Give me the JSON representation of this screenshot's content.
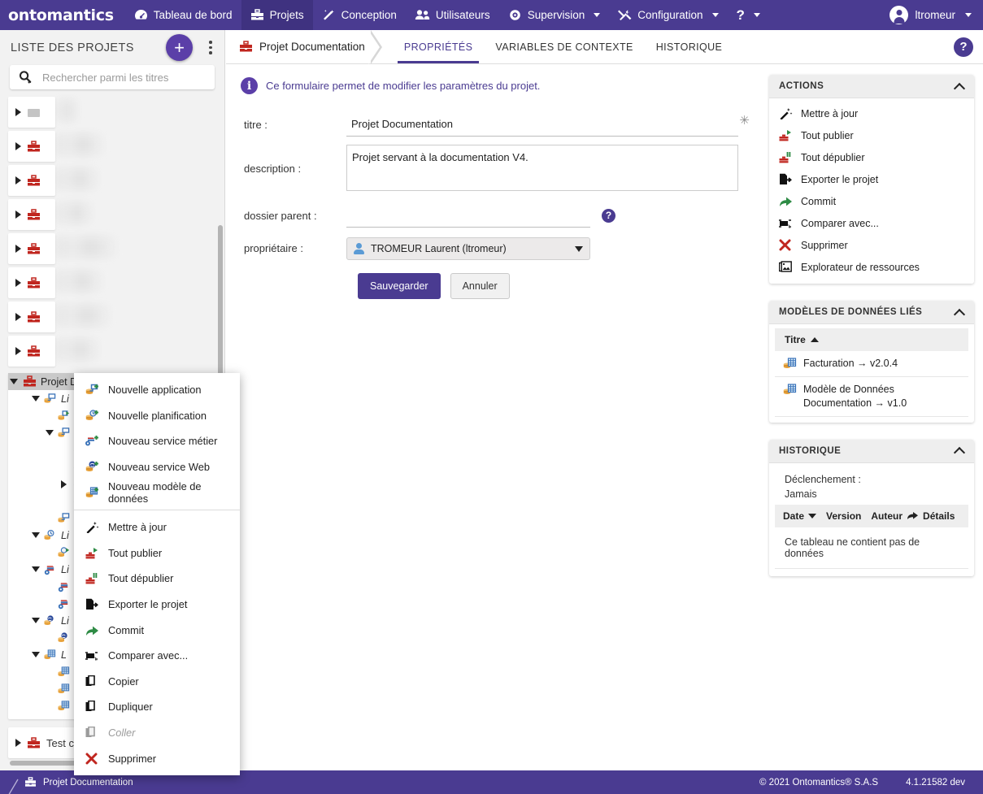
{
  "topnav": {
    "brand": "ontomantics",
    "items": [
      {
        "label": "Tableau de bord",
        "icon": "dashboard-icon",
        "caret": false,
        "active": false
      },
      {
        "label": "Projets",
        "icon": "toolbox-icon",
        "caret": false,
        "active": true
      },
      {
        "label": "Conception",
        "icon": "wand-icon",
        "caret": false,
        "active": false
      },
      {
        "label": "Utilisateurs",
        "icon": "users-icon",
        "caret": false,
        "active": false
      },
      {
        "label": "Supervision",
        "icon": "eye-icon",
        "caret": true,
        "active": false
      },
      {
        "label": "Configuration",
        "icon": "tools-icon",
        "caret": true,
        "active": false
      },
      {
        "label": "?",
        "icon": "help-icon",
        "caret": true,
        "active": false
      }
    ],
    "user": "ltromeur"
  },
  "sidebar": {
    "title": "LISTE DES PROJETS",
    "add_label": "+",
    "search_placeholder": "Rechercher parmi les titres",
    "search_value": "",
    "redacted_rows": 8,
    "selected_project": "Projet Documentation",
    "tree": [
      {
        "indent": 1,
        "twisty": "down",
        "icon": "app-list-icon",
        "label": "Li",
        "italic": true
      },
      {
        "indent": 2,
        "twisty": "none",
        "icon": "app-run-icon",
        "label": "",
        "italic": false
      },
      {
        "indent": 2,
        "twisty": "down",
        "icon": "app-icon",
        "label": "",
        "italic": false
      },
      {
        "indent": 3,
        "twisty": "none",
        "icon": "bolt-icon",
        "label": "",
        "italic": false
      },
      {
        "indent": 3,
        "twisty": "none",
        "icon": "bolt-icon",
        "label": "",
        "italic": false
      },
      {
        "indent": 3,
        "twisty": "right",
        "icon": "bolt-icon",
        "label": "",
        "italic": false
      },
      {
        "indent": 3,
        "twisty": "none",
        "icon": "bolt-icon",
        "label": "",
        "italic": false
      },
      {
        "indent": 2,
        "twisty": "none",
        "icon": "app-icon",
        "label": "",
        "italic": false
      },
      {
        "indent": 1,
        "twisty": "down",
        "icon": "schedule-list-icon",
        "label": "Li",
        "italic": true
      },
      {
        "indent": 2,
        "twisty": "none",
        "icon": "schedule-run-icon",
        "label": "",
        "italic": false
      },
      {
        "indent": 1,
        "twisty": "down",
        "icon": "service-list-icon",
        "label": "Li",
        "italic": true
      },
      {
        "indent": 2,
        "twisty": "none",
        "icon": "service-icon",
        "label": "",
        "italic": false
      },
      {
        "indent": 2,
        "twisty": "none",
        "icon": "service-icon",
        "label": "",
        "italic": false
      },
      {
        "indent": 1,
        "twisty": "down",
        "icon": "webservice-list-icon",
        "label": "Li",
        "italic": true
      },
      {
        "indent": 2,
        "twisty": "none",
        "icon": "webservice-icon",
        "label": "",
        "italic": false
      },
      {
        "indent": 1,
        "twisty": "down",
        "icon": "datamodel-list-icon",
        "label": "L",
        "italic": true
      },
      {
        "indent": 2,
        "twisty": "none",
        "icon": "datamodel-icon",
        "label": "",
        "italic": false
      },
      {
        "indent": 2,
        "twisty": "none",
        "icon": "datamodel-icon",
        "label": "",
        "italic": false
      },
      {
        "indent": 2,
        "twisty": "none",
        "icon": "datamodel-icon",
        "label": "",
        "italic": false
      }
    ],
    "last_item": "Test c"
  },
  "workspace": {
    "breadcrumb": "Projet Documentation",
    "tabs": [
      {
        "label": "PROPRIÉTÉS",
        "active": true
      },
      {
        "label": "VARIABLES DE CONTEXTE",
        "active": false
      },
      {
        "label": "HISTORIQUE",
        "active": false
      }
    ],
    "help_glyph": "?"
  },
  "form": {
    "info_banner": "Ce formulaire permet de modifier les paramètres du projet.",
    "info_glyph": "i",
    "fields": {
      "title_label": "titre :",
      "title_value": "Projet Documentation",
      "title_required_mark": "✳",
      "description_label": "description :",
      "description_value": "Projet servant à la documentation V4.",
      "parent_label": "dossier parent :",
      "parent_value": "",
      "parent_help_glyph": "?",
      "owner_label": "propriétaire :",
      "owner_value": "TROMEUR Laurent (ltromeur)"
    },
    "save_label": "Sauvegarder",
    "cancel_label": "Annuler"
  },
  "actions_panel": {
    "title": "ACTIONS",
    "items": [
      {
        "label": "Mettre à jour",
        "icon": "wand-icon"
      },
      {
        "label": "Tout publier",
        "icon": "publish-icon"
      },
      {
        "label": "Tout dépublier",
        "icon": "unpublish-icon"
      },
      {
        "label": "Exporter le projet",
        "icon": "export-icon"
      },
      {
        "label": "Commit",
        "icon": "commit-arrow-icon"
      },
      {
        "label": "Comparer avec...",
        "icon": "compare-icon"
      },
      {
        "label": "Supprimer",
        "icon": "delete-x-icon"
      },
      {
        "label": "Explorateur de ressources",
        "icon": "resource-explorer-icon"
      }
    ]
  },
  "datamodels_panel": {
    "title": "MODÈLES DE DONNÉES LIÉS",
    "column_header": "Titre",
    "sort_direction": "asc",
    "rows": [
      {
        "label": "Facturation → v2.0.4",
        "icon": "datamodel-icon"
      },
      {
        "label": "Modèle de Données Documentation → v1.0",
        "icon": "datamodel-icon"
      }
    ]
  },
  "history_panel": {
    "title": "HISTORIQUE",
    "trigger_label": "Déclenchement :",
    "trigger_value": "Jamais",
    "columns": [
      "Date",
      "Version",
      "Auteur",
      "Détails"
    ],
    "sort_column": "Date",
    "sort_direction": "desc",
    "empty_message": "Ce tableau ne contient pas de données"
  },
  "context_menu": {
    "groups": [
      [
        {
          "label": "Nouvelle application",
          "icon": "new-application-icon",
          "disabled": false
        },
        {
          "label": "Nouvelle planification",
          "icon": "new-schedule-icon",
          "disabled": false
        },
        {
          "label": "Nouveau service métier",
          "icon": "new-business-service-icon",
          "disabled": false
        },
        {
          "label": "Nouveau service Web",
          "icon": "new-web-service-icon",
          "disabled": false
        },
        {
          "label": "Nouveau modèle de données",
          "icon": "new-datamodel-icon",
          "disabled": false
        }
      ],
      [
        {
          "label": "Mettre à jour",
          "icon": "wand-icon",
          "disabled": false
        },
        {
          "label": "Tout publier",
          "icon": "publish-icon",
          "disabled": false
        },
        {
          "label": "Tout dépublier",
          "icon": "unpublish-icon",
          "disabled": false
        },
        {
          "label": "Exporter le projet",
          "icon": "export-icon",
          "disabled": false
        },
        {
          "label": "Commit",
          "icon": "commit-arrow-icon",
          "disabled": false
        },
        {
          "label": "Comparer avec...",
          "icon": "compare-icon",
          "disabled": false
        },
        {
          "label": "Copier",
          "icon": "copy-icon",
          "disabled": false
        },
        {
          "label": "Dupliquer",
          "icon": "duplicate-icon",
          "disabled": false
        },
        {
          "label": "Coller",
          "icon": "paste-icon",
          "disabled": true
        },
        {
          "label": "Supprimer",
          "icon": "delete-x-icon",
          "disabled": false
        }
      ]
    ]
  },
  "footer": {
    "crumb": "Projet Documentation",
    "copyright": "© 2021 Ontomantics® S.A.S",
    "version": "4.1.21582 dev"
  },
  "colors": {
    "brand_purple": "#4a3b91",
    "brand_purple_dark": "#3f3280",
    "accent_violet": "#5b3fa8",
    "panel_head": "#eeeeee",
    "sidebar_bg": "#f2f2f2",
    "danger_red": "#c0261f",
    "green": "#2e8b45"
  }
}
